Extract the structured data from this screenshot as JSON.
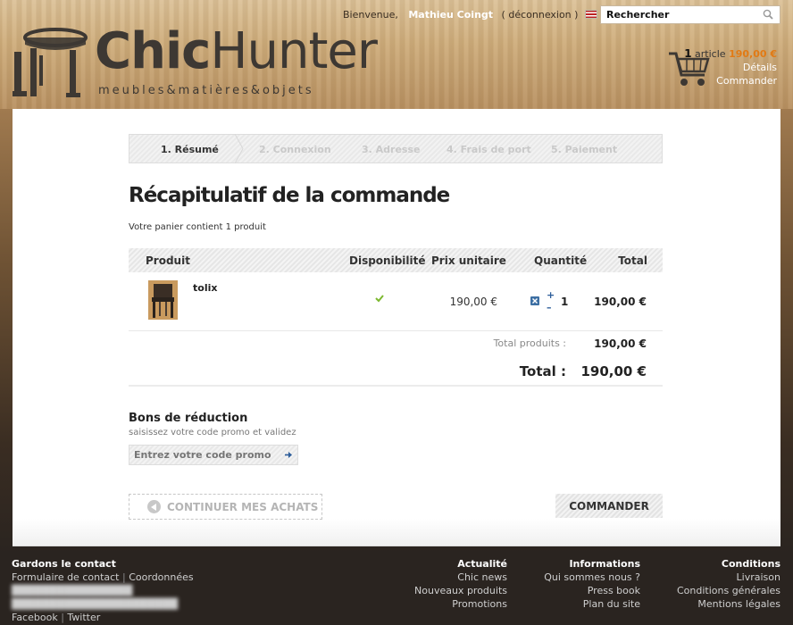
{
  "header": {
    "welcome": "Bienvenue,",
    "user_name": "Mathieu Coingt",
    "logout_label": "déconnexion",
    "search_value": "Rechercher",
    "logo_chic": "Chic",
    "logo_hunter": "Hunter",
    "tagline": "meubles&matières&objets"
  },
  "cart_summary": {
    "count": "1",
    "word": "article",
    "price": "190,00 €",
    "details_label": "Détails",
    "order_label": "Commander"
  },
  "steps": [
    {
      "label": "1. Résumé",
      "active": true
    },
    {
      "label": "2. Connexion",
      "active": false
    },
    {
      "label": "3. Adresse",
      "active": false
    },
    {
      "label": "4. Frais de port",
      "active": false
    },
    {
      "label": "5. Paiement",
      "active": false
    }
  ],
  "page": {
    "title": "Récapitulatif de la commande",
    "cart_text": "Votre panier contient 1 produit"
  },
  "table": {
    "headers": {
      "product": "Produit",
      "availability": "Disponibilité",
      "unit_price": "Prix unitaire",
      "quantity": "Quantité",
      "total": "Total"
    },
    "rows": [
      {
        "name": "tolix",
        "available": true,
        "unit_price": "190,00 €",
        "quantity": "1",
        "total": "190,00 €"
      }
    ],
    "total_products_label": "Total produits :",
    "total_products_value": "190,00 €",
    "total_label": "Total :",
    "total_value": "190,00 €"
  },
  "discount": {
    "title": "Bons de réduction",
    "subtitle": "saisissez votre code promo et validez",
    "placeholder": "Entrez votre code promo"
  },
  "actions": {
    "continue_label": "CONTINUER MES ACHATS",
    "order_label": "COMMANDER"
  },
  "footer": {
    "contact": {
      "title": "Gardons le contact",
      "contact_form": "Formulaire de contact",
      "coordinates": "Coordonnées",
      "facebook": "Facebook",
      "twitter": "Twitter"
    },
    "news": {
      "title": "Actualité",
      "items": [
        "Chic news",
        "Nouveaux produits",
        "Promotions"
      ]
    },
    "info": {
      "title": "Informations",
      "items": [
        "Qui sommes nous ?",
        "Press book",
        "Plan du site"
      ]
    },
    "conditions": {
      "title": "Conditions",
      "items": [
        "Livraison",
        "Conditions générales",
        "Mentions légales"
      ]
    }
  },
  "colors": {
    "accent": "#e27a14",
    "link_blue": "#2d5d9a",
    "check_green": "#7cb82f"
  }
}
